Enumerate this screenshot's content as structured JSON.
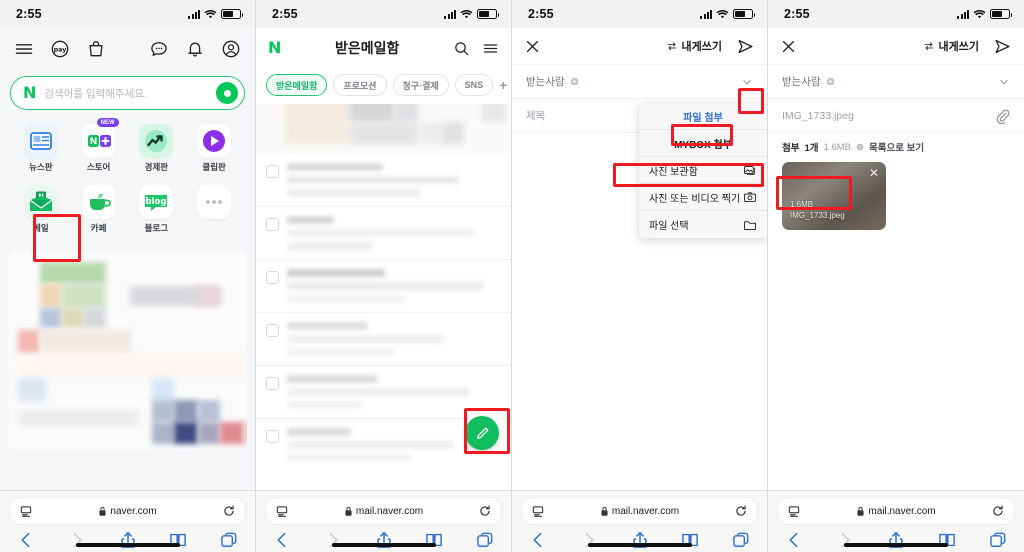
{
  "status_bar": {
    "time": "2:55",
    "battery_level": "40",
    "signal_icon": "cellular-signal-icon",
    "wifi_icon": "wifi-icon",
    "battery_icon": "battery-icon"
  },
  "colors": {
    "naver_green": "#04c75a",
    "accent_green": "#12bd5f",
    "highlight_red": "#ee1b23",
    "link_blue": "#2f6fd0",
    "chip_active": "#14b062"
  },
  "panel1": {
    "name": "naver-home",
    "nav_left": [
      {
        "name": "hamburger-menu-icon",
        "label": "메뉴"
      },
      {
        "name": "naver-pay-icon",
        "label": "pay"
      },
      {
        "name": "shopping-bag-icon",
        "label": "쇼핑"
      }
    ],
    "nav_right": [
      {
        "name": "chat-icon",
        "label": "톡톡"
      },
      {
        "name": "bell-icon",
        "label": "알림"
      },
      {
        "name": "profile-icon",
        "label": "내정보"
      }
    ],
    "search": {
      "logo": "N",
      "placeholder": "검색어를 입력해주세요.",
      "mic_icon": "voice-search-icon"
    },
    "apps": [
      {
        "label": "뉴스판",
        "icon": "news-icon",
        "badge": ""
      },
      {
        "label": "스토어",
        "icon": "store-icon",
        "badge": "NEW"
      },
      {
        "label": "경제판",
        "icon": "finance-icon",
        "badge": ""
      },
      {
        "label": "클립판",
        "icon": "clip-icon",
        "badge": ""
      },
      {
        "label": "메일",
        "icon": "mail-icon",
        "badge": ""
      },
      {
        "label": "카페",
        "icon": "cafe-icon",
        "badge": ""
      },
      {
        "label": "블로그",
        "icon": "blog-icon",
        "badge": ""
      },
      {
        "label": "",
        "icon": "more-dots-icon",
        "badge": ""
      }
    ],
    "browser": {
      "url": "naver.com",
      "lock_icon": "lock-icon",
      "reload_icon": "reload-icon",
      "reader_icon": "reader-view-icon"
    }
  },
  "panel2": {
    "name": "naver-mail-inbox",
    "header": {
      "logo": "N",
      "title": "받은메일함",
      "search_icon": "search-icon",
      "menu_icon": "hamburger-menu-icon"
    },
    "tabs": [
      {
        "label": "받은메일함",
        "active": true
      },
      {
        "label": "프로모션",
        "active": false
      },
      {
        "label": "청구·결제",
        "active": false
      },
      {
        "label": "SNS",
        "active": false
      },
      {
        "label": "+",
        "active": false
      }
    ],
    "compose_fab": {
      "name": "compose-fab",
      "icon": "pencil-icon"
    },
    "browser": {
      "url": "mail.naver.com",
      "lock_icon": "lock-icon",
      "reload_icon": "reload-icon",
      "reader_icon": "reader-view-icon"
    }
  },
  "panel3": {
    "name": "mail-compose-attach-menu",
    "header": {
      "close_icon": "close-icon",
      "self_send_label": "내게쓰기",
      "swap_icon": "swap-icon",
      "send_icon": "send-icon"
    },
    "fields": [
      {
        "label": "받는사람",
        "name": "recipient-field",
        "trailing": "chevron-down-icon"
      },
      {
        "label": "제목",
        "name": "subject-field",
        "trailing": "paperclip-icon"
      }
    ],
    "menu": [
      {
        "label": "파일 첨부",
        "icon": "",
        "type": "header"
      },
      {
        "label": "MYBOX 첨부",
        "icon": "",
        "type": "header2"
      },
      {
        "label": "사진 보관함",
        "icon": "photo-library-icon",
        "type": "item"
      },
      {
        "label": "사진 또는 비디오 찍기",
        "icon": "camera-icon",
        "type": "item"
      },
      {
        "label": "파일 선택",
        "icon": "folder-icon",
        "type": "item"
      }
    ],
    "browser": {
      "url": "mail.naver.com",
      "lock_icon": "lock-icon",
      "reload_icon": "reload-icon",
      "reader_icon": "reader-view-icon"
    }
  },
  "panel4": {
    "name": "mail-compose-attached",
    "header": {
      "close_icon": "close-icon",
      "self_send_label": "내게쓰기",
      "swap_icon": "swap-icon",
      "send_icon": "send-icon"
    },
    "fields": [
      {
        "label": "받는사람",
        "name": "recipient-field",
        "trailing": "chevron-down-icon"
      },
      {
        "label": "IMG_1733.jpeg",
        "name": "subject-field",
        "trailing": "paperclip-icon"
      }
    ],
    "attachment_summary": {
      "prefix": "첨부",
      "count": "1개",
      "size": "1.6MB",
      "link": "목록으로 보기",
      "info_icon": "info-icon"
    },
    "thumbnail": {
      "size": "1.6MB",
      "filename": "IMG_1733.jpeg",
      "remove_icon": "close-icon"
    },
    "browser": {
      "url": "mail.naver.com",
      "lock_icon": "lock-icon",
      "reload_icon": "reload-icon",
      "reader_icon": "reader-view-icon"
    }
  },
  "safari_tools": [
    {
      "name": "back-icon",
      "enabled": true
    },
    {
      "name": "forward-icon",
      "enabled": false
    },
    {
      "name": "share-icon",
      "enabled": true
    },
    {
      "name": "bookmarks-icon",
      "enabled": true
    },
    {
      "name": "tabs-icon",
      "enabled": true
    }
  ]
}
